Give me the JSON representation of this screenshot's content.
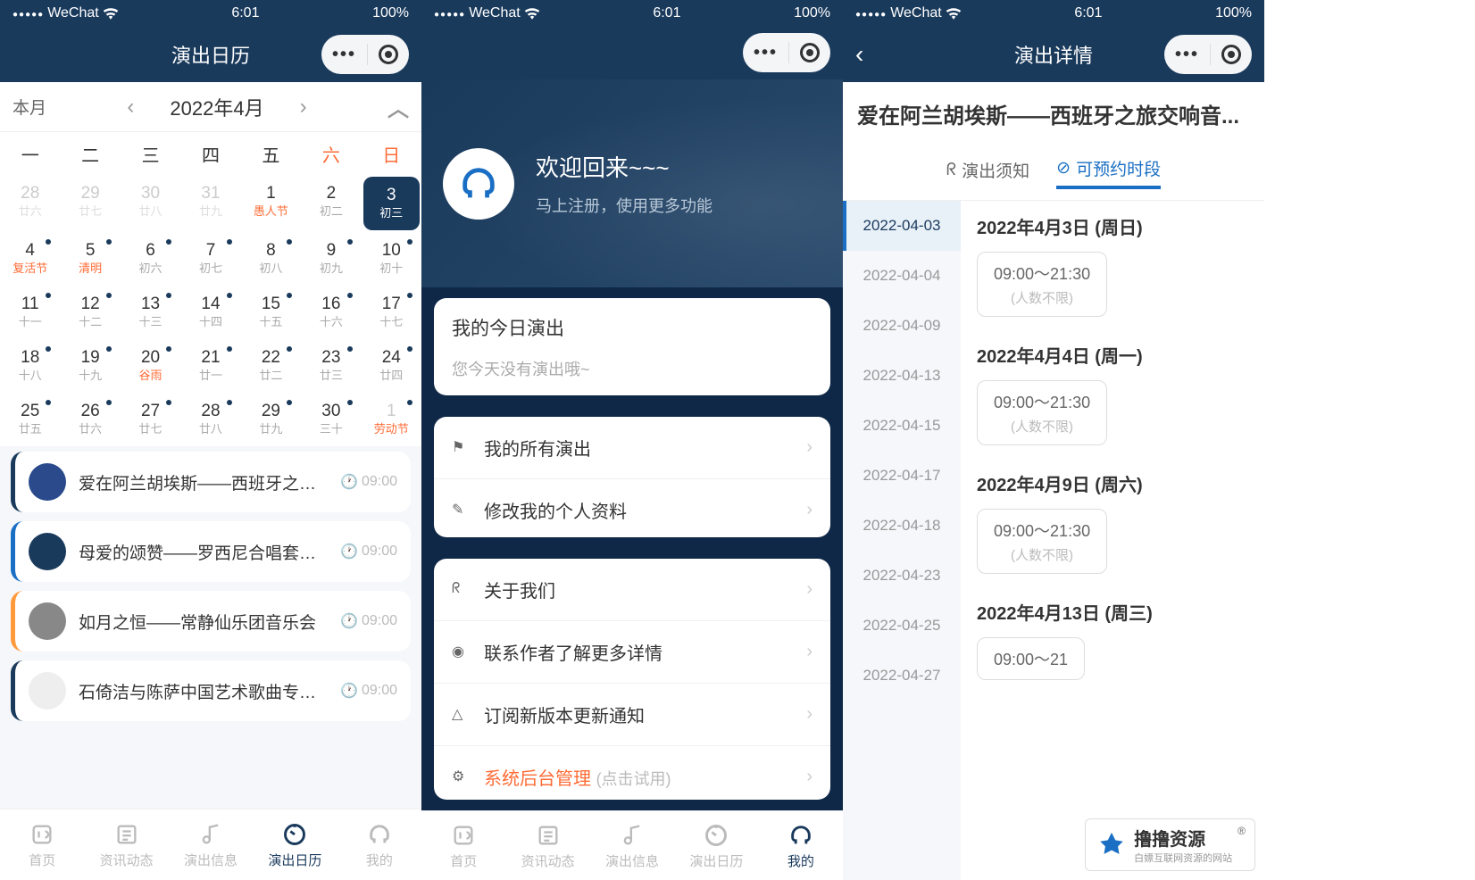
{
  "status": {
    "carrier": "WeChat",
    "time": "6:01",
    "battery": "100%"
  },
  "screen1": {
    "title": "演出日历",
    "month_label": "本月",
    "month_display": "2022年4月",
    "weekdays": [
      "一",
      "二",
      "三",
      "四",
      "五",
      "六",
      "日"
    ],
    "days": [
      {
        "n": "28",
        "s": "廿六",
        "other": true
      },
      {
        "n": "29",
        "s": "廿七",
        "other": true
      },
      {
        "n": "30",
        "s": "廿八",
        "other": true
      },
      {
        "n": "31",
        "s": "廿九",
        "other": true
      },
      {
        "n": "1",
        "s": "愚人节",
        "holiday": true
      },
      {
        "n": "2",
        "s": "初二"
      },
      {
        "n": "3",
        "s": "初三",
        "selected": true,
        "dot": true
      },
      {
        "n": "4",
        "s": "复活节",
        "dot": true,
        "holiday": true
      },
      {
        "n": "5",
        "s": "清明",
        "dot": true,
        "holiday": true
      },
      {
        "n": "6",
        "s": "初六",
        "dot": true
      },
      {
        "n": "7",
        "s": "初七",
        "dot": true
      },
      {
        "n": "8",
        "s": "初八",
        "dot": true
      },
      {
        "n": "9",
        "s": "初九",
        "dot": true
      },
      {
        "n": "10",
        "s": "初十",
        "dot": true
      },
      {
        "n": "11",
        "s": "十一",
        "dot": true
      },
      {
        "n": "12",
        "s": "十二",
        "dot": true
      },
      {
        "n": "13",
        "s": "十三",
        "dot": true
      },
      {
        "n": "14",
        "s": "十四",
        "dot": true
      },
      {
        "n": "15",
        "s": "十五",
        "dot": true
      },
      {
        "n": "16",
        "s": "十六",
        "dot": true
      },
      {
        "n": "17",
        "s": "十七",
        "dot": true
      },
      {
        "n": "18",
        "s": "十八",
        "dot": true
      },
      {
        "n": "19",
        "s": "十九",
        "dot": true
      },
      {
        "n": "20",
        "s": "谷雨",
        "dot": true,
        "holiday": true
      },
      {
        "n": "21",
        "s": "廿一",
        "dot": true
      },
      {
        "n": "22",
        "s": "廿二",
        "dot": true
      },
      {
        "n": "23",
        "s": "廿三",
        "dot": true
      },
      {
        "n": "24",
        "s": "廿四",
        "dot": true
      },
      {
        "n": "25",
        "s": "廿五",
        "dot": true
      },
      {
        "n": "26",
        "s": "廿六",
        "dot": true
      },
      {
        "n": "27",
        "s": "廿七",
        "dot": true
      },
      {
        "n": "28",
        "s": "廿八",
        "dot": true
      },
      {
        "n": "29",
        "s": "廿九",
        "dot": true
      },
      {
        "n": "30",
        "s": "三十",
        "dot": true
      },
      {
        "n": "1",
        "s": "劳动节",
        "other": true,
        "dot": true,
        "holiday": true
      }
    ],
    "events": [
      {
        "title": "爱在阿兰胡埃斯——西班牙之旅...",
        "time": "09:00",
        "color": "#1a3a5c",
        "avatar": "#2a4a8c"
      },
      {
        "title": "母爱的颂赞——罗西尼合唱套曲...",
        "time": "09:00",
        "color": "#1a6fc4",
        "avatar": "#1a3a5c"
      },
      {
        "title": "如月之恒——常静仙乐团音乐会",
        "time": "09:00",
        "color": "#ff9a3c",
        "avatar": "#888"
      },
      {
        "title": "石倚洁与陈萨中国艺术歌曲专场...",
        "time": "09:00",
        "color": "#1a3a5c",
        "avatar": "#eee"
      }
    ],
    "tabs": [
      {
        "label": "首页",
        "icon": "home"
      },
      {
        "label": "资讯动态",
        "icon": "news"
      },
      {
        "label": "演出信息",
        "icon": "music"
      },
      {
        "label": "演出日历",
        "icon": "calendar",
        "active": true
      },
      {
        "label": "我的",
        "icon": "headphones"
      }
    ]
  },
  "screen2": {
    "hero_title": "欢迎回来~~~",
    "hero_sub": "马上注册，使用更多功能",
    "card1_title": "我的今日演出",
    "card1_sub": "您今天没有演出哦~",
    "rows1": [
      {
        "icon": "flag",
        "text": "我的所有演出"
      },
      {
        "icon": "edit",
        "text": "修改我的个人资料"
      }
    ],
    "rows2": [
      {
        "icon": "people",
        "text": "关于我们"
      },
      {
        "icon": "globe",
        "text": "联系作者了解更多详情"
      },
      {
        "icon": "bell",
        "text": "订阅新版本更新通知"
      },
      {
        "icon": "gear",
        "text": "系统后台管理",
        "hint": "(点击试用)",
        "red": true
      }
    ],
    "tabs": [
      {
        "label": "首页"
      },
      {
        "label": "资讯动态"
      },
      {
        "label": "演出信息"
      },
      {
        "label": "演出日历"
      },
      {
        "label": "我的",
        "active": true
      }
    ]
  },
  "screen3": {
    "nav_title": "演出详情",
    "title": "爱在阿兰胡埃斯——西班牙之旅交响音...",
    "tab1": "演出须知",
    "tab2": "可预约时段",
    "dates": [
      "2022-04-03",
      "2022-04-04",
      "2022-04-09",
      "2022-04-13",
      "2022-04-15",
      "2022-04-17",
      "2022-04-18",
      "2022-04-23",
      "2022-04-25",
      "2022-04-27"
    ],
    "slots": [
      {
        "date": "2022年4月3日 (周日)",
        "time": "09:00～21:30",
        "note": "(人数不限)"
      },
      {
        "date": "2022年4月4日 (周一)",
        "time": "09:00～21:30",
        "note": "(人数不限)"
      },
      {
        "date": "2022年4月9日 (周六)",
        "time": "09:00～21:30",
        "note": "(人数不限)"
      },
      {
        "date": "2022年4月13日 (周三)",
        "time": "09:00～21",
        "note": ""
      }
    ]
  },
  "watermark": {
    "brand": "撸撸资源",
    "sub": "白嫖互联网资源的网站"
  }
}
